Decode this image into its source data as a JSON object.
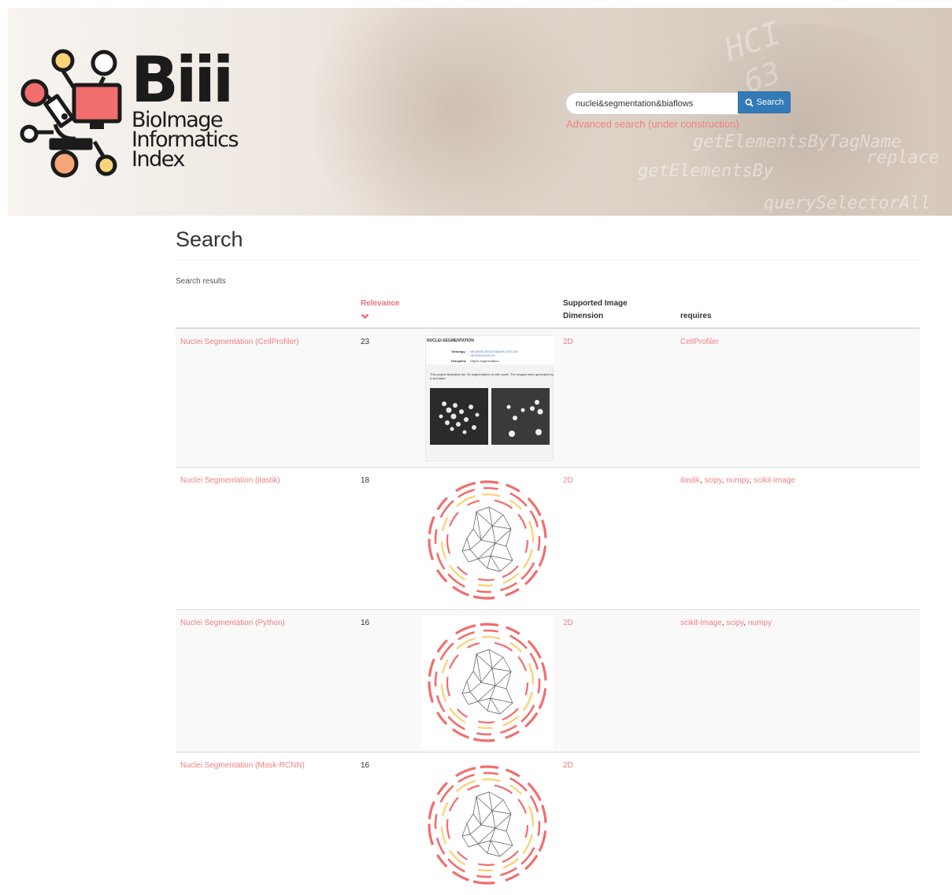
{
  "header": {
    "logo_title": "Biii",
    "logo_subtitle": [
      "BioImage",
      "Informatics",
      "Index"
    ],
    "search_value": "nuclei&segmentation&biaflows",
    "search_button": "Search",
    "advanced_search": "Advanced search (under construction)",
    "background_code": [
      "getElementsByTagName",
      "replace",
      "getElementsBy",
      "querySelectorAll",
      "HCI",
      "63"
    ]
  },
  "page": {
    "title": "Search",
    "results_label": "Search results"
  },
  "table": {
    "columns": {
      "relevance": "Relevance",
      "dimension_line1": "Supported Image",
      "dimension_line2": "Dimension",
      "requires": "requires"
    },
    "rows": [
      {
        "title": "Nuclei Segmentation (CellProfiler)",
        "relevance": "23",
        "dimension": "2D",
        "requires": [
          "CellProfiler"
        ],
        "thumb": {
          "heading": "NUCLEI-SEGMENTATION",
          "ontology_label": "Ontology",
          "ontology_value": "NEUBIAS-BENCHMARK-NUCLEI-SEGMENTATION",
          "discipline_label": "Discipline",
          "discipline_value": "Object segmentation",
          "desc": "This project illustrates the 2D segmentation of cell nuclei. The images were generated by a simulator."
        }
      },
      {
        "title": "Nuclei Segmentation (ilastik)",
        "relevance": "18",
        "dimension": "2D",
        "requires": [
          "ilastik",
          "scipy",
          "numpy",
          "scikit-image"
        ]
      },
      {
        "title": "Nuclei Segmentation (Python)",
        "relevance": "16",
        "dimension": "2D",
        "requires": [
          "scikit-image",
          "scipy",
          "numpy"
        ]
      },
      {
        "title": "Nuclei Segmentation (Mask-RCNN)",
        "relevance": "16",
        "dimension": "2D",
        "requires": []
      }
    ]
  },
  "colors": {
    "link": "#f08080",
    "button": "#337ab7",
    "logo_red": "#f26d6d",
    "logo_yellow": "#f9d47a",
    "logo_orange": "#f7a679"
  }
}
